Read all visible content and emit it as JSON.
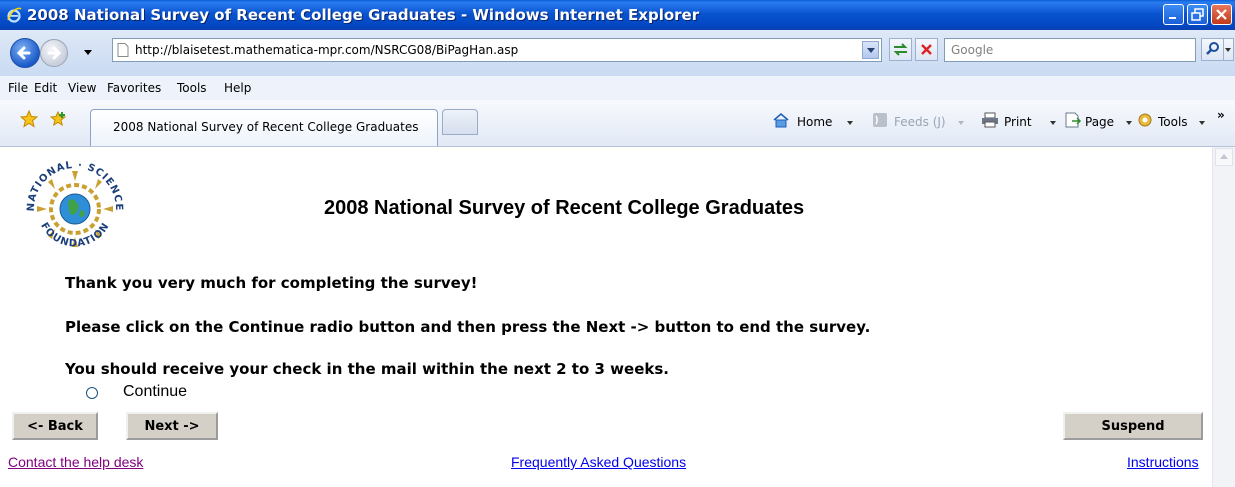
{
  "window": {
    "title": "2008 National Survey of Recent College Graduates - Windows Internet Explorer"
  },
  "address_bar": {
    "url": "http://blaisetest.mathematica-mpr.com/NSRCG08/BiPagHan.asp",
    "search_placeholder": "Google"
  },
  "menu": [
    "File",
    "Edit",
    "View",
    "Favorites",
    "Tools",
    "Help"
  ],
  "tabs": {
    "active_label": "2008 National Survey of Recent College Graduates"
  },
  "command_bar": {
    "home": "Home",
    "feeds": "Feeds (J)",
    "print": "Print",
    "page": "Page",
    "tools": "Tools"
  },
  "page": {
    "logo_text": "NATIONAL SCIENCE FOUNDATION",
    "title": "2008 National Survey of Recent College Graduates",
    "messages": [
      "Thank you very much for completing the survey!",
      "Please click on the Continue radio button and then press the Next -> button to end the survey.",
      "You should receive your check in the mail within the next 2 to 3 weeks."
    ],
    "radio_label": "Continue",
    "buttons": {
      "back": "<- Back",
      "next": "Next ->",
      "suspend": "Suspend"
    },
    "links": {
      "help_desk": "Contact the help desk",
      "faq": "Frequently Asked Questions",
      "instructions": "Instructions"
    }
  },
  "colors": {
    "titlebar": "#0347c2",
    "visited_link": "#800080",
    "link": "#0000ee"
  }
}
